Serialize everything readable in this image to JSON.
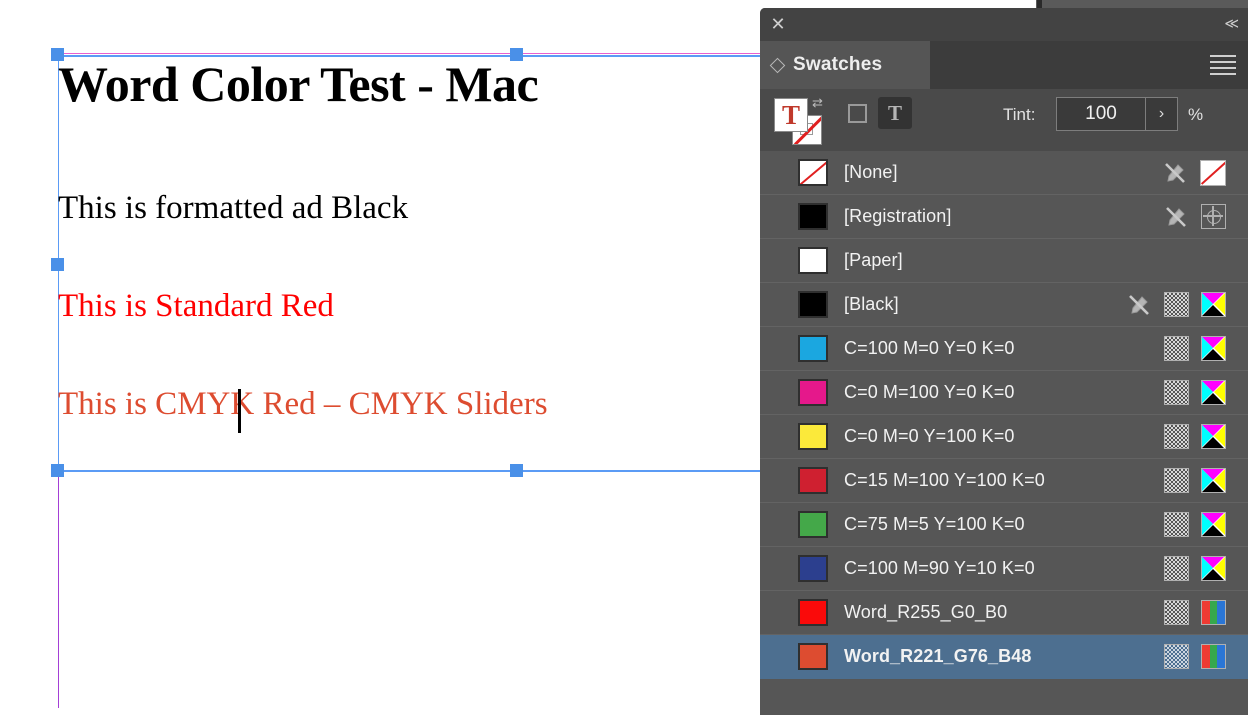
{
  "document": {
    "title_text": "Word Color Test - Mac",
    "line_black": "This is formatted ad Black",
    "line_standard_red": "This is Standard Red",
    "line_cmyk_red": "This is CMYK Red – CMYK Sliders",
    "title_color": "#000000",
    "black_color": "#000000",
    "standard_red_color": "#ff0000",
    "cmyk_red_color": "#dd4c30",
    "frame_stroke_color": "#5b9bf5",
    "handle_color": "#4a90e8",
    "margin_guide_color": "#e85fd0",
    "column_guide_color": "#a43fd6"
  },
  "panel": {
    "close_icon": "✕",
    "collapse_icon": "≪",
    "tab_label": "Swatches",
    "menu_icon": "panel-menu-icon",
    "swap_icon": "⇄",
    "fill_proxy_glyph": "T",
    "format_text_glyph": "T",
    "tint_label": "Tint:",
    "tint_value": "100",
    "tint_stepper_icon": "›",
    "tint_unit": "%",
    "selected_swatch": "Word_R221_G76_B48",
    "selection_color": "#4d6f90",
    "panel_bg": "#434343",
    "list_bg": "#565656"
  },
  "swatches": [
    {
      "name": "[None]",
      "color": "none",
      "chip": "none",
      "locked": true,
      "mode": "none"
    },
    {
      "name": "[Registration]",
      "color": "#000000",
      "chip": "solid",
      "locked": true,
      "mode": "registration"
    },
    {
      "name": "[Paper]",
      "color": "#ffffff",
      "chip": "solid",
      "locked": false,
      "mode": ""
    },
    {
      "name": "[Black]",
      "color": "#000000",
      "chip": "solid",
      "locked": true,
      "mode": "cmyk"
    },
    {
      "name": "C=100 M=0 Y=0 K=0",
      "color": "#1ba7e0",
      "chip": "solid",
      "locked": false,
      "mode": "cmyk"
    },
    {
      "name": "C=0 M=100 Y=0 K=0",
      "color": "#e5188b",
      "chip": "solid",
      "locked": false,
      "mode": "cmyk"
    },
    {
      "name": "C=0 M=0 Y=100 K=0",
      "color": "#fbe93a",
      "chip": "solid",
      "locked": false,
      "mode": "cmyk"
    },
    {
      "name": "C=15 M=100 Y=100 K=0",
      "color": "#cf2030",
      "chip": "solid",
      "locked": false,
      "mode": "cmyk"
    },
    {
      "name": "C=75 M=5 Y=100 K=0",
      "color": "#44a849",
      "chip": "solid",
      "locked": false,
      "mode": "cmyk"
    },
    {
      "name": "C=100 M=90 Y=10 K=0",
      "color": "#2c3f8e",
      "chip": "solid",
      "locked": false,
      "mode": "cmyk"
    },
    {
      "name": "Word_R255_G0_B0",
      "color": "#fa0a0a",
      "chip": "solid",
      "locked": false,
      "mode": "rgb"
    },
    {
      "name": "Word_R221_G76_B48",
      "color": "#dd4c30",
      "chip": "solid",
      "locked": false,
      "mode": "rgb",
      "selected": true
    }
  ],
  "rgb_icon_colors": {
    "r": "#ee3b33",
    "g": "#36a84d",
    "b": "#2a76d6"
  }
}
